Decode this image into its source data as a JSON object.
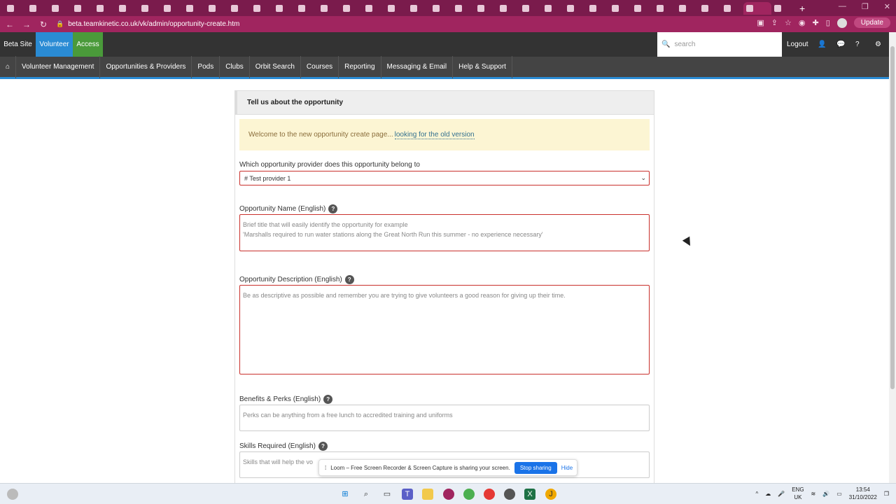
{
  "browser": {
    "url": "beta.teamkinetic.co.uk/vk/admin/opportunity-create.htm",
    "update_label": "Update",
    "tab_count": 35
  },
  "site_top": {
    "beta_site": "Beta Site",
    "volunteer": "Volunteer",
    "access": "Access",
    "search_placeholder": "search",
    "logout": "Logout",
    "colors": {
      "volunteer": "#2a8bd4",
      "access": "#4a9a3a",
      "bar": "#333333"
    }
  },
  "nav": {
    "items": [
      "Volunteer Management",
      "Opportunities & Providers",
      "Pods",
      "Clubs",
      "Orbit Search",
      "Courses",
      "Reporting",
      "Messaging & Email",
      "Help & Support"
    ]
  },
  "form": {
    "panel_title": "Tell us about the opportunity",
    "notice_text": "Welcome to the new opportunity create page...",
    "notice_link": "looking for the old version",
    "provider_label": "Which opportunity provider does this opportunity belong to",
    "provider_value": "# Test provider 1",
    "name_label": "Opportunity Name (English)",
    "name_placeholder_line1": "Brief title that will easily identify the opportunity for example",
    "name_placeholder_line2": "'Marshalls required to run water stations along the Great North Run this summer - no experience necessary'",
    "desc_label": "Opportunity Description (English)",
    "desc_placeholder": "Be as descriptive as possible and remember you are trying to give volunteers a good reason for giving up their time.",
    "perks_label": "Benefits & Perks (English)",
    "perks_placeholder": "Perks can be anything from a free lunch to accredited training and uniforms",
    "skills_label": "Skills Required (English)",
    "skills_placeholder": "Skills that will help the vo"
  },
  "loom": {
    "message": "Loom – Free Screen Recorder & Screen Capture is sharing your screen.",
    "stop_label": "Stop sharing",
    "hide_label": "Hide"
  },
  "taskbar": {
    "lang_line1": "ENG",
    "lang_line2": "UK",
    "time": "13:54",
    "date": "31/10/2022"
  }
}
